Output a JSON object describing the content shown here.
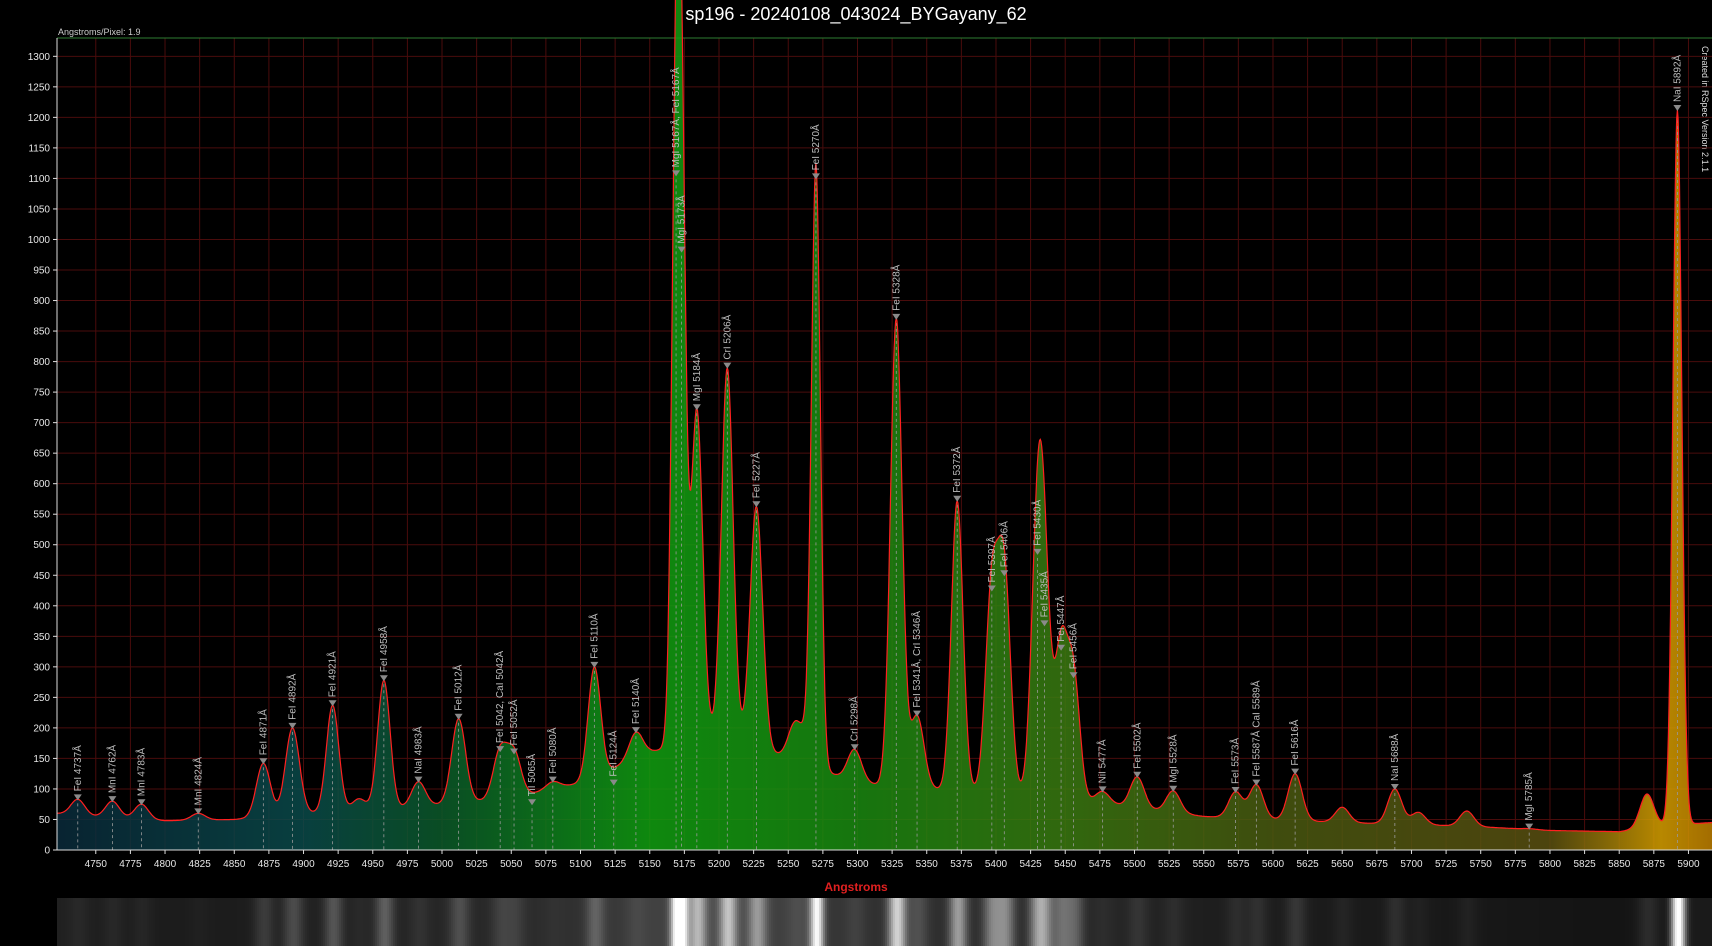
{
  "chart_data": {
    "type": "line",
    "title": "sp196 - 20240108_043024_BYGayany_62",
    "note": "Angstroms/Pixel: 1.9",
    "credit": "Created in RSpec Version 2.1.1",
    "xlabel": "Angstroms",
    "ylabel": "",
    "xlim": [
      4722,
      5917
    ],
    "ylim": [
      0,
      1330
    ],
    "x_ticks": [
      4750,
      4775,
      4800,
      4825,
      4850,
      4875,
      4900,
      4925,
      4950,
      4975,
      5000,
      5025,
      5050,
      5075,
      5100,
      5125,
      5150,
      5175,
      5200,
      5225,
      5250,
      5275,
      5300,
      5325,
      5350,
      5375,
      5400,
      5425,
      5450,
      5475,
      5500,
      5525,
      5550,
      5575,
      5600,
      5625,
      5650,
      5675,
      5700,
      5725,
      5750,
      5775,
      5800,
      5825,
      5850,
      5875,
      5900
    ],
    "y_ticks": [
      0,
      50,
      100,
      150,
      200,
      250,
      300,
      350,
      400,
      450,
      500,
      550,
      600,
      650,
      700,
      750,
      800,
      850,
      900,
      950,
      1000,
      1050,
      1100,
      1150,
      1200,
      1250,
      1300
    ],
    "grid": true,
    "line_color": "#ff2020",
    "baseline": [
      [
        4722,
        60
      ],
      [
        4750,
        55
      ],
      [
        4800,
        48
      ],
      [
        4850,
        50
      ],
      [
        4900,
        60
      ],
      [
        4950,
        65
      ],
      [
        5000,
        75
      ],
      [
        5050,
        85
      ],
      [
        5100,
        110
      ],
      [
        5150,
        160
      ],
      [
        5200,
        190
      ],
      [
        5250,
        150
      ],
      [
        5300,
        110
      ],
      [
        5350,
        100
      ],
      [
        5400,
        95
      ],
      [
        5450,
        85
      ],
      [
        5500,
        70
      ],
      [
        5550,
        55
      ],
      [
        5600,
        50
      ],
      [
        5650,
        45
      ],
      [
        5700,
        42
      ],
      [
        5750,
        38
      ],
      [
        5800,
        32
      ],
      [
        5850,
        30
      ],
      [
        5880,
        40
      ],
      [
        5917,
        45
      ]
    ],
    "peaks": [
      {
        "x": 4737,
        "y": 83,
        "label": "FeI 4737Å"
      },
      {
        "x": 4762,
        "y": 80,
        "label": "MnI 4762Å"
      },
      {
        "x": 4783,
        "y": 75,
        "label": "MnI 4783Å"
      },
      {
        "x": 4824,
        "y": 60,
        "label": "MnI 4824Å"
      },
      {
        "x": 4871,
        "y": 142,
        "label": "FeI 4871Å"
      },
      {
        "x": 4892,
        "y": 200,
        "label": "FeI 4892Å"
      },
      {
        "x": 4921,
        "y": 237,
        "label": "FeI 4921Å"
      },
      {
        "x": 4958,
        "y": 278,
        "label": "FeI 4958Å"
      },
      {
        "x": 4983,
        "y": 112,
        "label": "NaI 4983Å"
      },
      {
        "x": 5012,
        "y": 215,
        "label": "FeI 5012Å"
      },
      {
        "x": 5042,
        "y": 162,
        "label": "FeI 5042, CaI 5042Å"
      },
      {
        "x": 5052,
        "y": 158,
        "label": "FeI 5052Å"
      },
      {
        "x": 5065,
        "y": 75,
        "label": "TiI 5065Å"
      },
      {
        "x": 5080,
        "y": 112,
        "label": "FeI 5080Å"
      },
      {
        "x": 5110,
        "y": 300,
        "label": "FeI 5110Å"
      },
      {
        "x": 5124,
        "y": 107,
        "label": "FeI 5124Å"
      },
      {
        "x": 5140,
        "y": 193,
        "label": "FeI 5140Å"
      },
      {
        "x": 5169,
        "y": 1105,
        "label": "MgI 5167Å, FeI 5167Å"
      },
      {
        "x": 5173,
        "y": 980,
        "label": "MgI 5173Å"
      },
      {
        "x": 5184,
        "y": 722,
        "label": "MgI 5184Å"
      },
      {
        "x": 5206,
        "y": 790,
        "label": "CrI 5206Å"
      },
      {
        "x": 5227,
        "y": 563,
        "label": "FeI 5227Å"
      },
      {
        "x": 5270,
        "y": 1100,
        "label": "FeI 5270Å"
      },
      {
        "x": 5298,
        "y": 165,
        "label": "CrI 5298Å"
      },
      {
        "x": 5328,
        "y": 870,
        "label": "FeI 5328Å"
      },
      {
        "x": 5343,
        "y": 220,
        "label": "FeI 5341Å, CrI 5346Å"
      },
      {
        "x": 5372,
        "y": 572,
        "label": "FeI 5372Å"
      },
      {
        "x": 5397,
        "y": 425,
        "label": "FeI 5397Å"
      },
      {
        "x": 5406,
        "y": 450,
        "label": "FeI 5406Å"
      },
      {
        "x": 5430,
        "y": 485,
        "label": "FeI 5430Å"
      },
      {
        "x": 5435,
        "y": 368,
        "label": "FeI 5435Å"
      },
      {
        "x": 5447,
        "y": 328,
        "label": "FeI 5447Å"
      },
      {
        "x": 5456,
        "y": 283,
        "label": "FeI 5456Å"
      },
      {
        "x": 5477,
        "y": 96,
        "label": "NiI 5477Å"
      },
      {
        "x": 5502,
        "y": 120,
        "label": "FeI 5502Å"
      },
      {
        "x": 5528,
        "y": 97,
        "label": "MgI 5528Å"
      },
      {
        "x": 5573,
        "y": 95,
        "label": "FeI 5573Å"
      },
      {
        "x": 5588,
        "y": 107,
        "label": "FeI 5587Å CaI 5589Å"
      },
      {
        "x": 5616,
        "y": 125,
        "label": "FeI 5616Å"
      },
      {
        "x": 5688,
        "y": 100,
        "label": "NaI 5688Å"
      },
      {
        "x": 5785,
        "y": 35,
        "label": "MgI 5785Å"
      },
      {
        "x": 5892,
        "y": 1212,
        "label": "NaI 5892Å"
      }
    ],
    "extra_bumps": [
      [
        4850,
        0
      ],
      [
        4940,
        20
      ],
      [
        5255,
        60
      ],
      [
        5265,
        40
      ],
      [
        5380,
        0
      ],
      [
        5650,
        25
      ],
      [
        5705,
        20
      ],
      [
        5740,
        25
      ],
      [
        5870,
        55
      ]
    ]
  }
}
